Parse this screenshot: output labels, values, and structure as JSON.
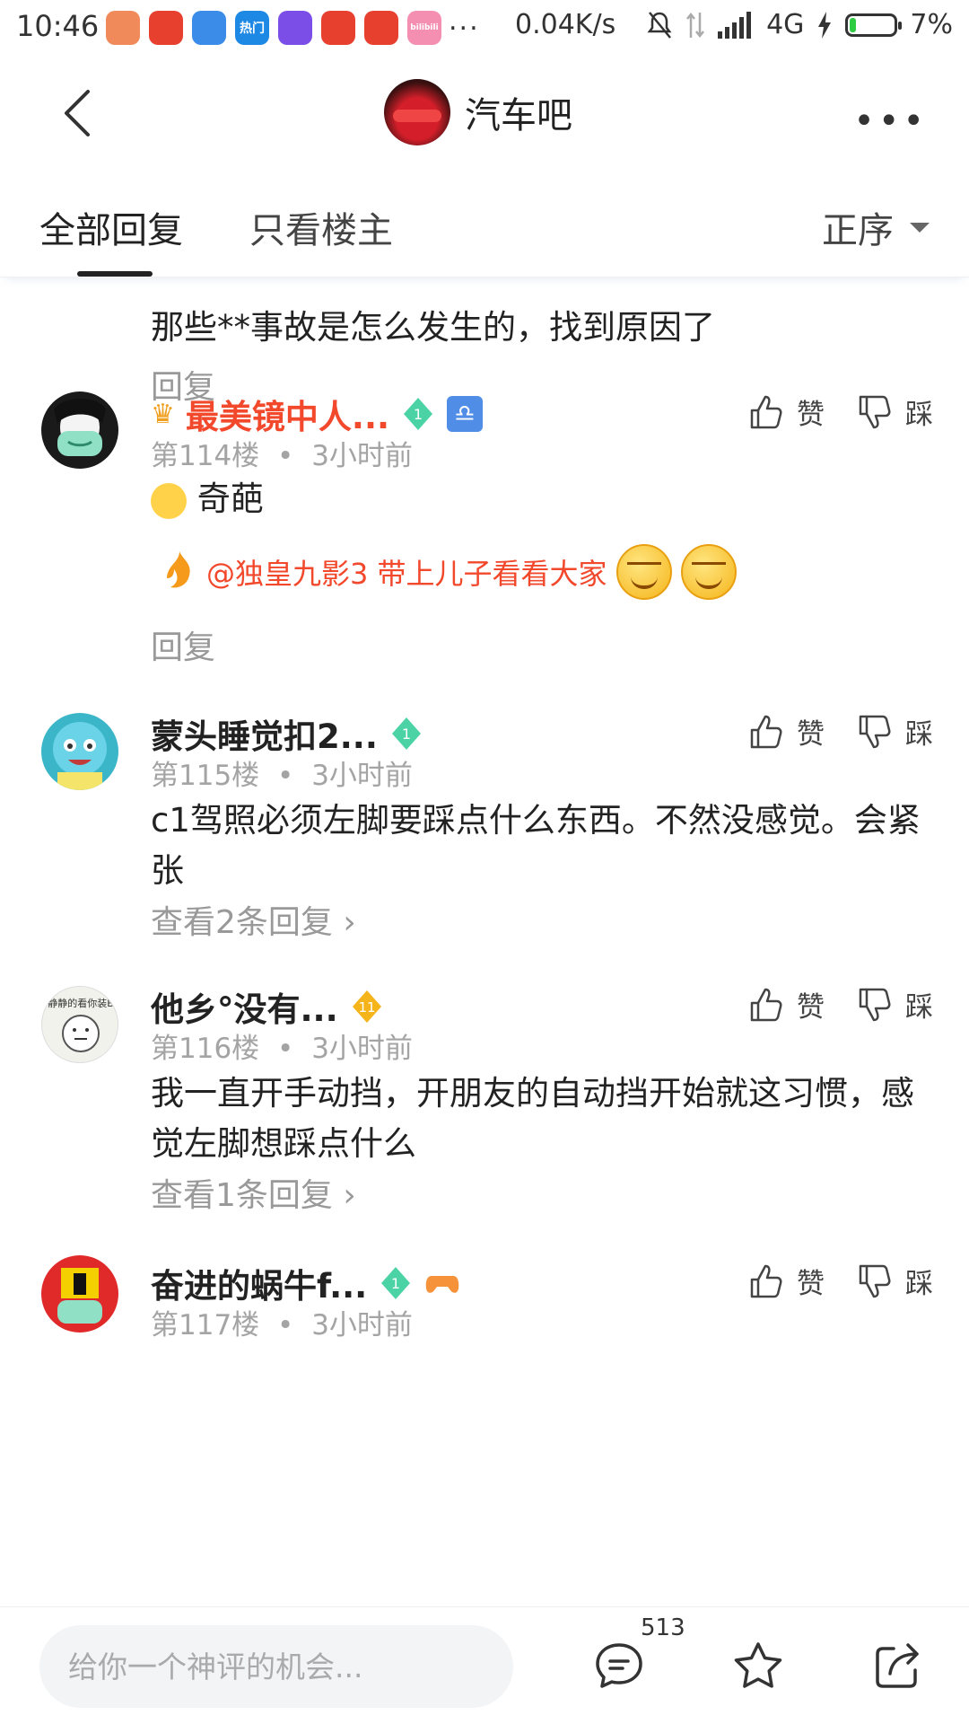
{
  "status_bar": {
    "time": "10:46",
    "more": "...",
    "network_speed": "0.04K/s",
    "network_type": "4G",
    "battery": "7%",
    "battery_level": 0.07,
    "apps": [
      "app-1",
      "app-2",
      "app-3",
      "热门",
      "app-5",
      "app-6",
      "app-7",
      "bilibili"
    ]
  },
  "header": {
    "forum_name": "汽车吧"
  },
  "tabs": {
    "all": "全部回复",
    "owner_only": "只看楼主",
    "sort": "正序"
  },
  "prev_post": {
    "text": "那些**事故是怎么发生的，找到原因了",
    "reply": "回复"
  },
  "posts": [
    {
      "username": "最美镜中人...",
      "level": "1",
      "floor": "第114楼",
      "time": "3小时前",
      "text": "奇葩",
      "mention": "@独皇九影3 带上儿子看看大家",
      "reply": "回复",
      "like": "赞",
      "dislike": "踩"
    },
    {
      "username": "蒙头睡觉扣2...",
      "level": "1",
      "floor": "第115楼",
      "time": "3小时前",
      "text": "c1驾照必须左脚要踩点什么东西。不然没感觉。会紧张",
      "more_replies": "查看2条回复",
      "like": "赞",
      "dislike": "踩"
    },
    {
      "username": "他乡°没有...",
      "level": "11",
      "floor": "第116楼",
      "time": "3小时前",
      "text": "我一直开手动挡，开朋友的自动挡开始就这习惯，感觉左脚想踩点什么",
      "more_replies": "查看1条回复",
      "like": "赞",
      "dislike": "踩",
      "avatar_text": "静静的看你装B"
    },
    {
      "username": "奋进的蜗牛f...",
      "level": "1",
      "floor": "第117楼",
      "time": "3小时前",
      "like": "赞",
      "dislike": "踩"
    }
  ],
  "meta_separator": "•",
  "chevron": "›",
  "bottom_bar": {
    "placeholder": "给你一个神评的机会...",
    "comment_count": "513"
  },
  "colors": {
    "vip_name": "#f2482c",
    "level_green": "#4cd3a5",
    "level_gold": "#f5b41a",
    "muted": "#a4a4a4"
  }
}
